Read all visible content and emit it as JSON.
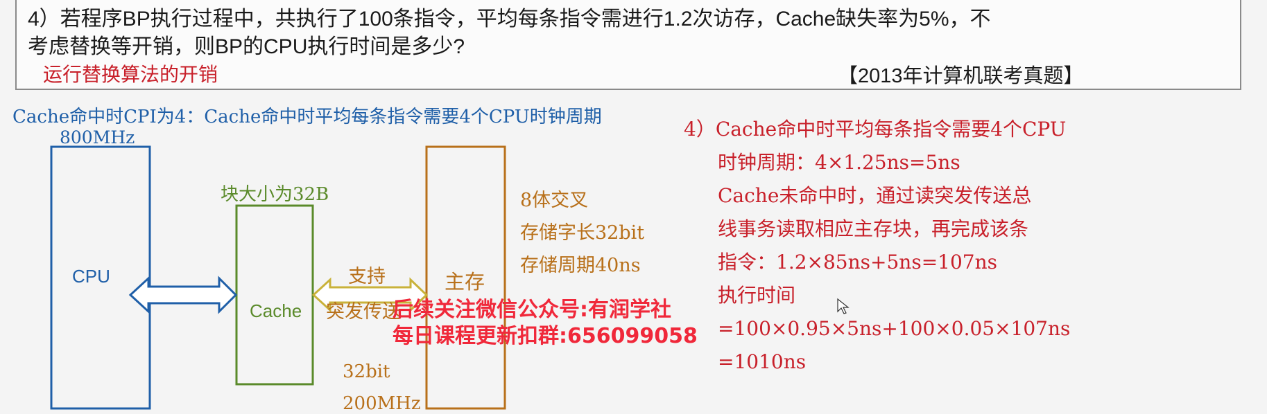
{
  "question": {
    "line1": "4）若程序BP执行过程中，共执行了100条指令，平均每条指令需进行1.2次访存，Cache缺失率为5%，不",
    "line2": "考虑替换等开销，则BP的CPU执行时间是多少?",
    "note": "运行替换算法的开销",
    "source": "【2013年计算机联考真题】"
  },
  "header": {
    "cpi_line": "Cache命中时CPI为4：Cache命中时平均每条指令需要4个CPU时钟周期"
  },
  "diagram": {
    "cpu_freq": "800MHz",
    "cpu_label": "CPU",
    "block_size": "块大小为32B",
    "cache_label": "Cache",
    "burst_line1": "支持",
    "burst_line2": "突发传送",
    "bus_width": "32bit",
    "bus_freq": "200MHz",
    "mem_label": "主存",
    "mem_info": [
      "8体交叉",
      "存储字长32bit",
      "存储周期40ns"
    ]
  },
  "answer": {
    "lines": [
      "4）Cache命中时平均每条指令需要4个CPU",
      "时钟周期：4×1.25ns=5ns",
      "Cache未命中时，通过读突发传送总",
      "线事务读取相应主存块，再完成该条",
      "指令：1.2×85ns+5ns=107ns",
      "执行时间",
      "=100×0.95×5ns+100×0.05×107ns",
      "=1010ns"
    ]
  },
  "watermark": {
    "line1": "后续关注微信公众号:有润学社",
    "line2": "每日课程更新扣群:656099058"
  },
  "colors": {
    "blue": "#1f5fa8",
    "green": "#5a8a2a",
    "orange": "#b8701a",
    "red": "#c8202a",
    "watermark": "#f0283a"
  }
}
